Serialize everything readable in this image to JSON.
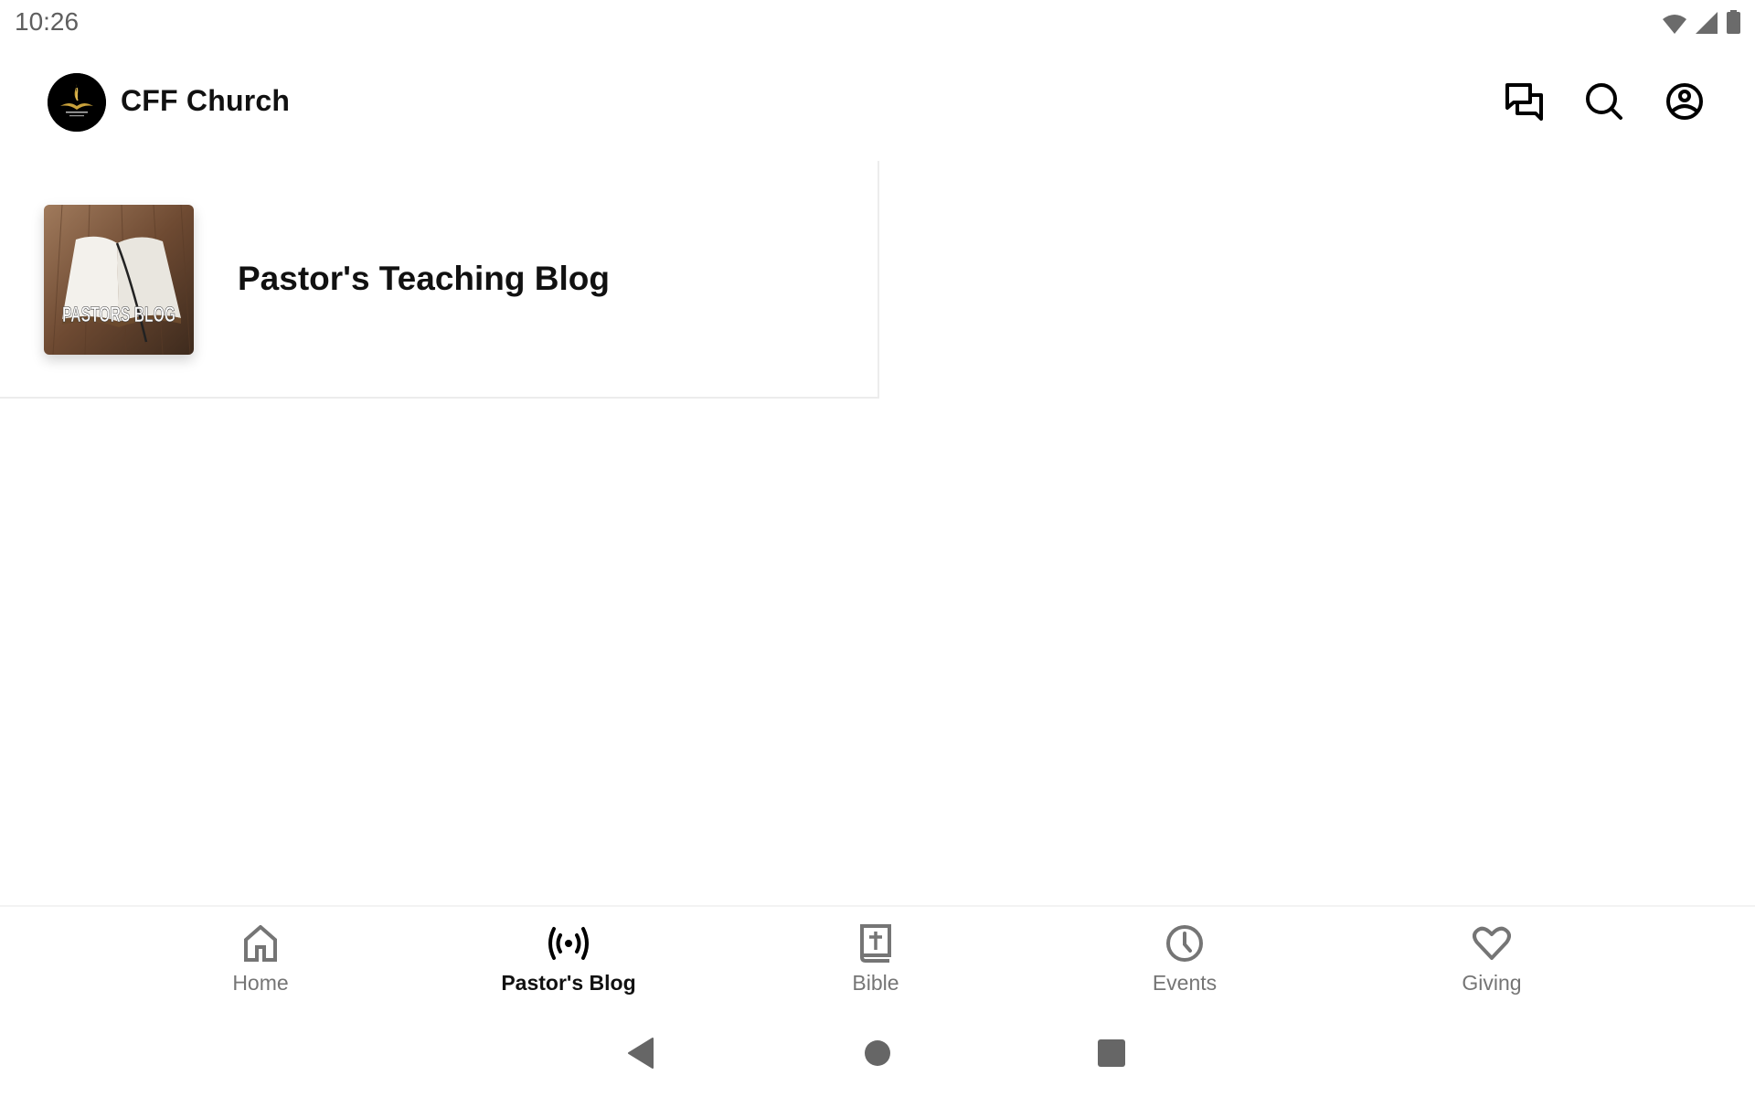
{
  "status_bar": {
    "time": "10:26",
    "icons": [
      "wifi-icon",
      "cell-signal-icon",
      "battery-icon"
    ]
  },
  "app_bar": {
    "logo_alt": "Christian Faith Fellowship logo",
    "title": "CFF Church",
    "actions": [
      {
        "name": "messages",
        "icon": "chat-bubbles-icon"
      },
      {
        "name": "search",
        "icon": "search-icon"
      },
      {
        "name": "profile",
        "icon": "account-circle-icon"
      }
    ]
  },
  "content": {
    "items": [
      {
        "title": "Pastor's Teaching Blog",
        "thumbnail_text": "PASTORS BLOG"
      }
    ]
  },
  "bottom_nav": {
    "active": "Pastor's Blog",
    "items": [
      {
        "label": "Home",
        "icon": "home-icon"
      },
      {
        "label": "Pastor's Blog",
        "icon": "broadcast-icon"
      },
      {
        "label": "Bible",
        "icon": "bible-icon"
      },
      {
        "label": "Events",
        "icon": "clock-icon"
      },
      {
        "label": "Giving",
        "icon": "heart-icon"
      }
    ]
  },
  "system_nav": [
    "back",
    "home",
    "recents"
  ],
  "colors": {
    "text_primary": "#111111",
    "text_inactive": "#757575",
    "system_icon": "#666666",
    "divider": "#ececec"
  }
}
